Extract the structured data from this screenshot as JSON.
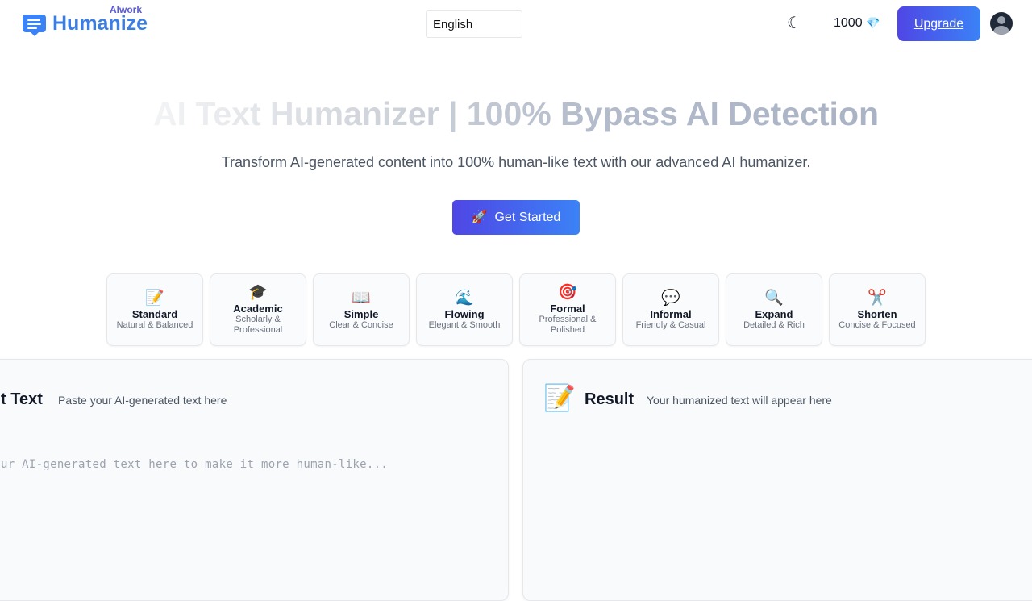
{
  "header": {
    "brand_top": "AIwork",
    "brand": "Humanize",
    "language": "English",
    "credits": "1000",
    "credits_icon": "gem-icon",
    "upgrade_label": "Upgrade"
  },
  "hero": {
    "title": "AI Text Humanizer | 100% Bypass AI Detection",
    "subtitle": "Transform AI-generated content into 100% human-like text with our advanced AI humanizer.",
    "cta_icon": "🚀",
    "cta_label": "Get Started"
  },
  "modes": [
    {
      "icon": "📝",
      "name": "Standard",
      "desc": "Natural & Balanced"
    },
    {
      "icon": "🎓",
      "name": "Academic",
      "desc": "Scholarly & Professional"
    },
    {
      "icon": "📖",
      "name": "Simple",
      "desc": "Clear & Concise"
    },
    {
      "icon": "🌊",
      "name": "Flowing",
      "desc": "Elegant & Smooth"
    },
    {
      "icon": "🎯",
      "name": "Formal",
      "desc": "Professional & Polished"
    },
    {
      "icon": "💬",
      "name": "Informal",
      "desc": "Friendly & Casual"
    },
    {
      "icon": "🔍",
      "name": "Expand",
      "desc": "Detailed & Rich"
    },
    {
      "icon": "✂️",
      "name": "Shorten",
      "desc": "Concise & Focused"
    }
  ],
  "input_panel": {
    "title": "t Text",
    "subtitle": "Paste your AI-generated text here",
    "placeholder": "ur AI-generated text here to make it more human-like..."
  },
  "result_panel": {
    "icon": "📝",
    "title": "Result",
    "subtitle": "Your humanized text will appear here"
  },
  "colors": {
    "accent_start": "#4f46e5",
    "accent_end": "#3b82f6",
    "brand": "#3b7de0"
  }
}
